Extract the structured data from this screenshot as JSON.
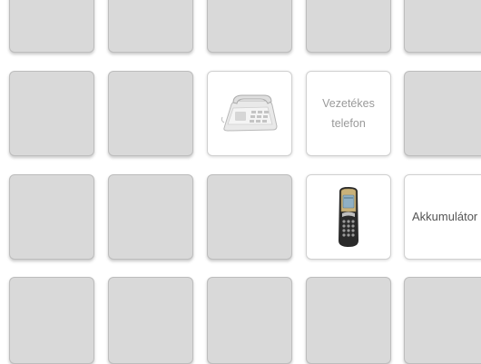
{
  "game": {
    "cards": {
      "landline_word": "Vezetékes\ntelefon",
      "battery_word": "Akkumulátor"
    },
    "icons": {
      "landline_image": "landline-phone-icon",
      "mobile_image": "mobile-phone-icon"
    }
  }
}
